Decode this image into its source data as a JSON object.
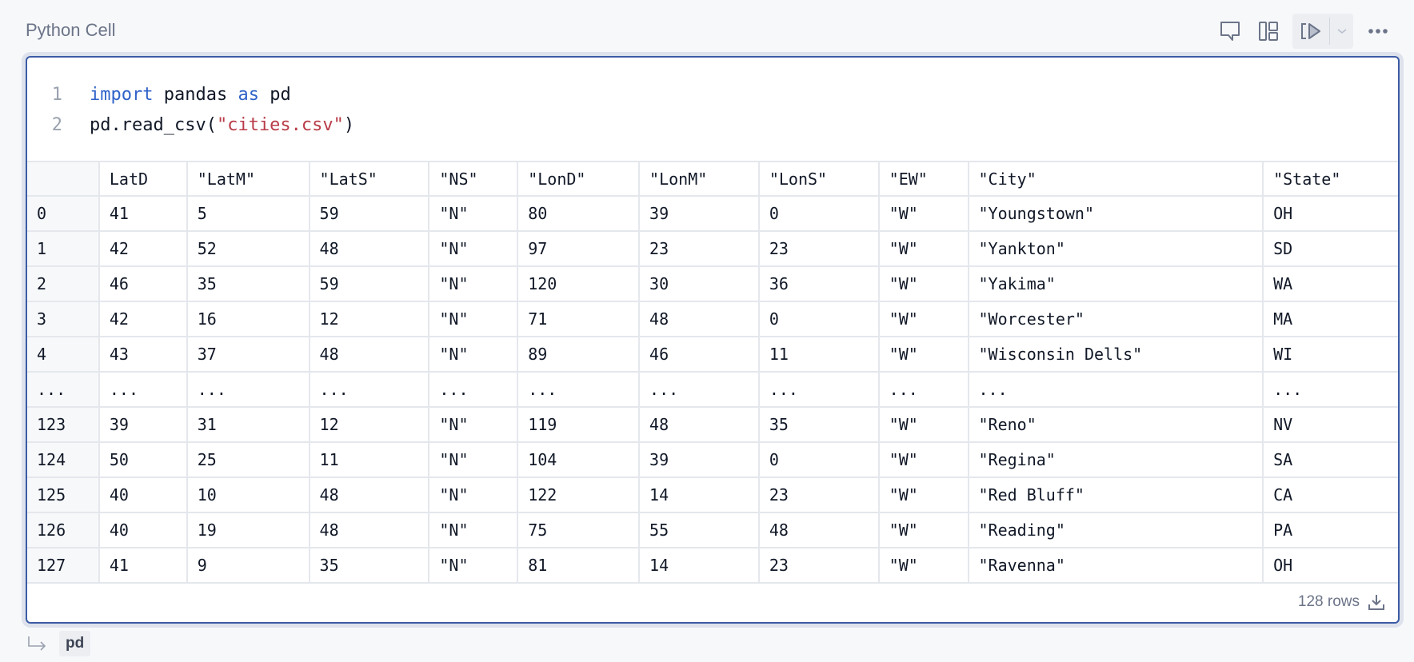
{
  "cell": {
    "label": "Python Cell"
  },
  "toolbar": {
    "icons": [
      "comment-icon",
      "layout-icon",
      "run-all-icon",
      "chevron-down-icon",
      "more-icon"
    ]
  },
  "code": {
    "lines": [
      {
        "number": "1",
        "tokens": [
          {
            "t": "import",
            "c": "kw"
          },
          {
            "t": " pandas ",
            "c": "tx"
          },
          {
            "t": "as",
            "c": "kw"
          },
          {
            "t": " pd",
            "c": "tx"
          }
        ]
      },
      {
        "number": "2",
        "tokens": [
          {
            "t": "pd.read_csv(",
            "c": "tx"
          },
          {
            "t": "\"cities.csv\"",
            "c": "str"
          },
          {
            "t": ")",
            "c": "tx"
          }
        ]
      }
    ]
  },
  "table": {
    "columns": [
      "",
      "LatD",
      "\"LatM\"",
      "\"LatS\"",
      "\"NS\"",
      "\"LonD\"",
      "\"LonM\"",
      "\"LonS\"",
      "\"EW\"",
      "\"City\"",
      "\"State\""
    ],
    "rows": [
      [
        "0",
        "41",
        "5",
        "59",
        "\"N\"",
        "80",
        "39",
        "0",
        "\"W\"",
        "\"Youngstown\"",
        "OH"
      ],
      [
        "1",
        "42",
        "52",
        "48",
        "\"N\"",
        "97",
        "23",
        "23",
        "\"W\"",
        "\"Yankton\"",
        "SD"
      ],
      [
        "2",
        "46",
        "35",
        "59",
        "\"N\"",
        "120",
        "30",
        "36",
        "\"W\"",
        "\"Yakima\"",
        "WA"
      ],
      [
        "3",
        "42",
        "16",
        "12",
        "\"N\"",
        "71",
        "48",
        "0",
        "\"W\"",
        "\"Worcester\"",
        "MA"
      ],
      [
        "4",
        "43",
        "37",
        "48",
        "\"N\"",
        "89",
        "46",
        "11",
        "\"W\"",
        "\"Wisconsin Dells\"",
        "WI"
      ],
      [
        "...",
        "...",
        "...",
        "...",
        "...",
        "...",
        "...",
        "...",
        "...",
        "...",
        "..."
      ],
      [
        "123",
        "39",
        "31",
        "12",
        "\"N\"",
        "119",
        "48",
        "35",
        "\"W\"",
        "\"Reno\"",
        "NV"
      ],
      [
        "124",
        "50",
        "25",
        "11",
        "\"N\"",
        "104",
        "39",
        "0",
        "\"W\"",
        "\"Regina\"",
        "SA"
      ],
      [
        "125",
        "40",
        "10",
        "48",
        "\"N\"",
        "122",
        "14",
        "23",
        "\"W\"",
        "\"Red Bluff\"",
        "CA"
      ],
      [
        "126",
        "40",
        "19",
        "48",
        "\"N\"",
        "75",
        "55",
        "48",
        "\"W\"",
        "\"Reading\"",
        "PA"
      ],
      [
        "127",
        "41",
        "9",
        "35",
        "\"N\"",
        "81",
        "14",
        "23",
        "\"W\"",
        "\"Ravenna\"",
        "OH"
      ]
    ],
    "row_count": "128 rows"
  },
  "output": {
    "variable": "pd"
  },
  "colors": {
    "accent": "#3b5ba5",
    "keyword": "#2f62c9",
    "string": "#b83c48"
  }
}
